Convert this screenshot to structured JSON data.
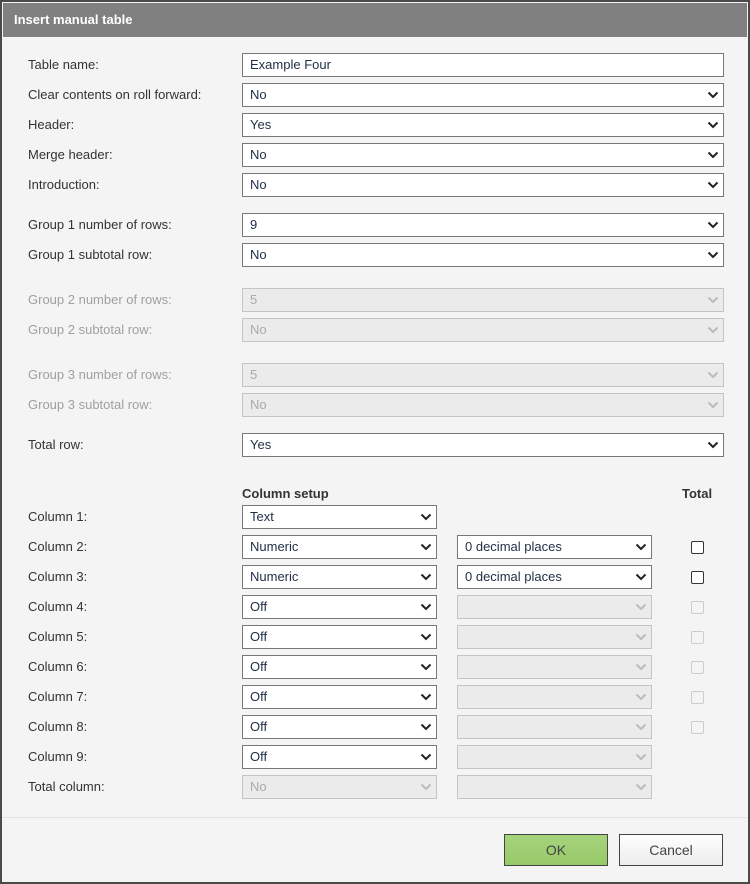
{
  "dialog": {
    "title": "Insert manual table"
  },
  "fields": [
    {
      "label": "Table name:",
      "type": "text",
      "value": "Example Four",
      "disabled": false
    },
    {
      "label": "Clear contents on roll forward:",
      "type": "select",
      "value": "No",
      "disabled": false
    },
    {
      "label": "Header:",
      "type": "select",
      "value": "Yes",
      "disabled": false
    },
    {
      "label": "Merge header:",
      "type": "select",
      "value": "No",
      "disabled": false
    },
    {
      "label": "Introduction:",
      "type": "select",
      "value": "No",
      "disabled": false
    },
    {
      "label": "Group 1 number of rows:",
      "type": "select",
      "value": "9",
      "disabled": false
    },
    {
      "label": "Group 1 subtotal row:",
      "type": "select",
      "value": "No",
      "disabled": false
    },
    {
      "label": "Group 2 number of rows:",
      "type": "select",
      "value": "5",
      "disabled": true
    },
    {
      "label": "Group 2 subtotal row:",
      "type": "select",
      "value": "No",
      "disabled": true
    },
    {
      "label": "Group 3 number of rows:",
      "type": "select",
      "value": "5",
      "disabled": true
    },
    {
      "label": "Group 3 subtotal row:",
      "type": "select",
      "value": "No",
      "disabled": true
    },
    {
      "label": "Total row:",
      "type": "select",
      "value": "Yes",
      "disabled": false
    }
  ],
  "column_setup": {
    "header": "Column setup",
    "total_header": "Total",
    "columns": [
      {
        "label": "Column 1:",
        "type": "Text",
        "format": null,
        "format_disabled": null,
        "total": null
      },
      {
        "label": "Column 2:",
        "type": "Numeric",
        "format": "0 decimal places",
        "format_disabled": false,
        "total": {
          "checked": false,
          "disabled": false
        }
      },
      {
        "label": "Column 3:",
        "type": "Numeric",
        "format": "0 decimal places",
        "format_disabled": false,
        "total": {
          "checked": false,
          "disabled": false
        }
      },
      {
        "label": "Column 4:",
        "type": "Off",
        "format": "",
        "format_disabled": true,
        "total": {
          "checked": false,
          "disabled": true
        }
      },
      {
        "label": "Column 5:",
        "type": "Off",
        "format": "",
        "format_disabled": true,
        "total": {
          "checked": false,
          "disabled": true
        }
      },
      {
        "label": "Column 6:",
        "type": "Off",
        "format": "",
        "format_disabled": true,
        "total": {
          "checked": false,
          "disabled": true
        }
      },
      {
        "label": "Column 7:",
        "type": "Off",
        "format": "",
        "format_disabled": true,
        "total": {
          "checked": false,
          "disabled": true
        }
      },
      {
        "label": "Column 8:",
        "type": "Off",
        "format": "",
        "format_disabled": true,
        "total": {
          "checked": false,
          "disabled": true
        }
      },
      {
        "label": "Column 9:",
        "type": "Off",
        "format": "",
        "format_disabled": true,
        "total": null
      },
      {
        "label": "Total column:",
        "type": "No",
        "type_disabled": true,
        "format": "",
        "format_disabled": true,
        "total": null
      }
    ]
  },
  "buttons": {
    "ok": "OK",
    "cancel": "Cancel"
  }
}
